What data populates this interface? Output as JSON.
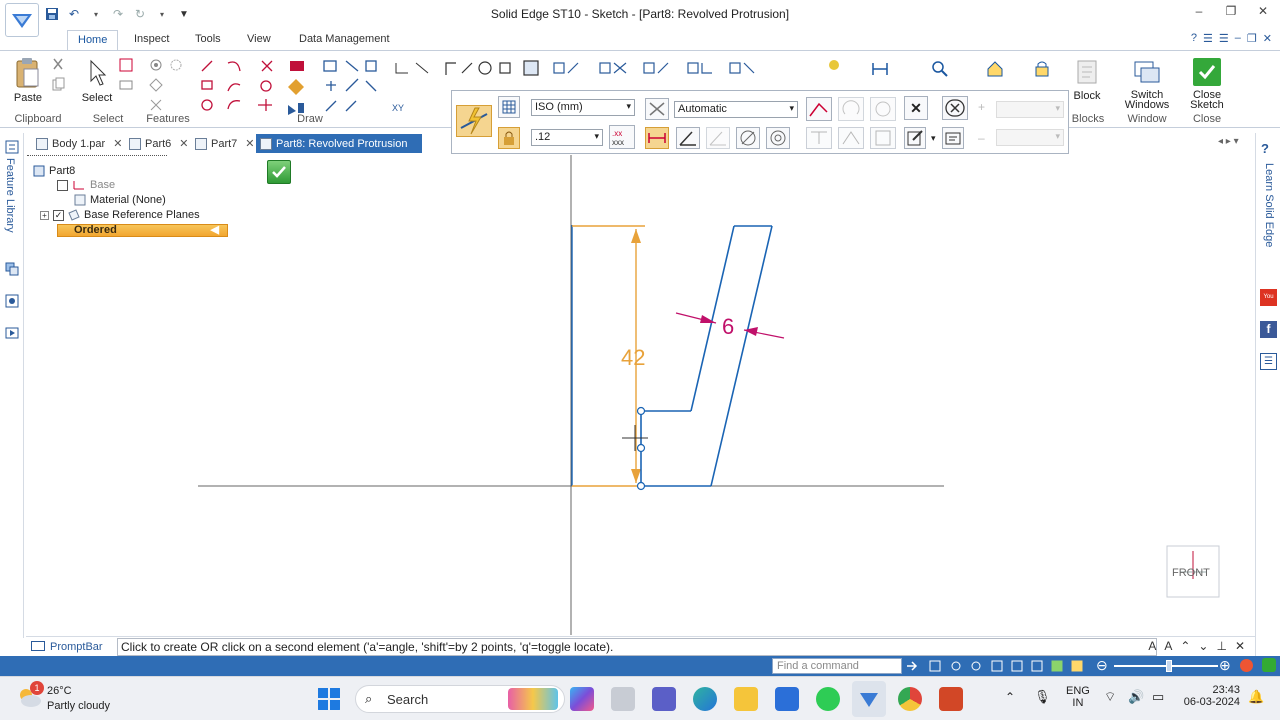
{
  "window": {
    "title": "Solid Edge ST10 - Sketch - [Part8: Revolved Protrusion]",
    "controls": [
      "–",
      "❐",
      "✕"
    ]
  },
  "ribbon": {
    "tabs": [
      "Home",
      "Inspect",
      "Tools",
      "View",
      "Data Management"
    ],
    "groups": {
      "clipboard": "Clipboard",
      "select": "Select",
      "features": "Features",
      "draw": "Draw",
      "blocks": "Blocks",
      "window": "Window",
      "close": "Close"
    },
    "buttons": {
      "paste": "Paste",
      "select": "Select",
      "block": "Block",
      "switch_windows": "Switch Windows",
      "close_sketch": "Close Sketch"
    }
  },
  "doc_tabs": [
    {
      "label": "Body 1.par"
    },
    {
      "label": "Part6"
    },
    {
      "label": "Part7"
    },
    {
      "label": "Part8: Revolved Protrusion"
    }
  ],
  "left_rail": {
    "label": "Feature Library"
  },
  "pathfinder": {
    "root": "Part8",
    "base": "Base",
    "material": "Material (None)",
    "ref_planes": "Base Reference Planes",
    "ordered": "Ordered"
  },
  "command_bar": {
    "units": "ISO (mm)",
    "precision": ".12",
    "mode": "Automatic",
    "plus": "+",
    "minus": "–"
  },
  "sketch": {
    "dim_vertical": "42",
    "dim_thickness": "6",
    "view_label": "FRONT"
  },
  "right_rail": {
    "label": "Learn Solid Edge"
  },
  "prompt_bar": {
    "title": "PromptBar",
    "message": "Click to create OR click on a second element ('a'=angle, 'shift'=by 2 points, 'q'=toggle locate)."
  },
  "status_bar": {
    "find_placeholder": "Find a command"
  },
  "taskbar": {
    "weather_temp": "26°C",
    "weather_desc": "Partly cloudy",
    "weather_badge": "1",
    "search": "Search",
    "lang_top": "ENG",
    "lang_bottom": "IN",
    "time": "23:43",
    "date": "06-03-2024"
  },
  "colors": {
    "accent": "#2f6db5",
    "sketch": "#1a64b4",
    "dimension_driving": "#e8a23a",
    "dimension_driven": "#c0106a"
  }
}
